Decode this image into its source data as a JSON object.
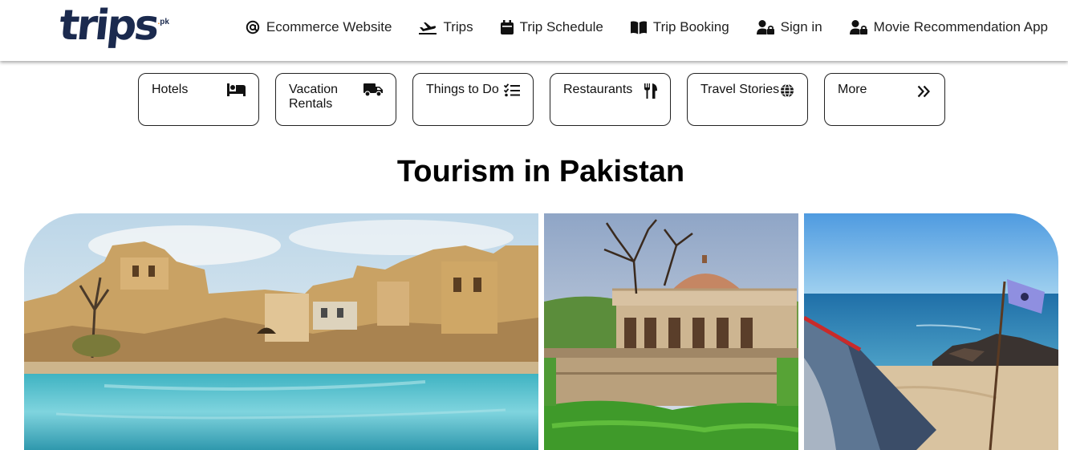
{
  "header": {
    "logo": {
      "main": "trips",
      "suffix": "pk"
    },
    "nav": [
      {
        "label": "Ecommerce Website",
        "icon": "at-icon"
      },
      {
        "label": "Trips",
        "icon": "plane-icon"
      },
      {
        "label": "Trip Schedule",
        "icon": "calendar-icon"
      },
      {
        "label": "Trip Booking",
        "icon": "book-icon"
      },
      {
        "label": "Sign in",
        "icon": "user-lock-icon"
      },
      {
        "label": "Movie Recommendation App",
        "icon": "user-lock-icon"
      }
    ]
  },
  "categories": [
    {
      "label": "Hotels",
      "icon": "bed-icon"
    },
    {
      "label": "Vacation Rentals",
      "icon": "truck-icon"
    },
    {
      "label": "Things to Do",
      "icon": "checklist-icon"
    },
    {
      "label": "Restaurants",
      "icon": "utensils-icon"
    },
    {
      "label": "Travel Stories",
      "icon": "globe-icon"
    },
    {
      "label": "More",
      "icon": "double-chevron-right-icon"
    }
  ],
  "page_title": "Tourism in Pakistan",
  "gallery": [
    {
      "subject": "temple-pond-photo"
    },
    {
      "subject": "domed-monument-photo"
    },
    {
      "subject": "beach-tent-photo"
    }
  ],
  "colors": {
    "logo_navy": "#1b2a4e",
    "logo_accent": "#f28c1a",
    "border": "#222222"
  }
}
